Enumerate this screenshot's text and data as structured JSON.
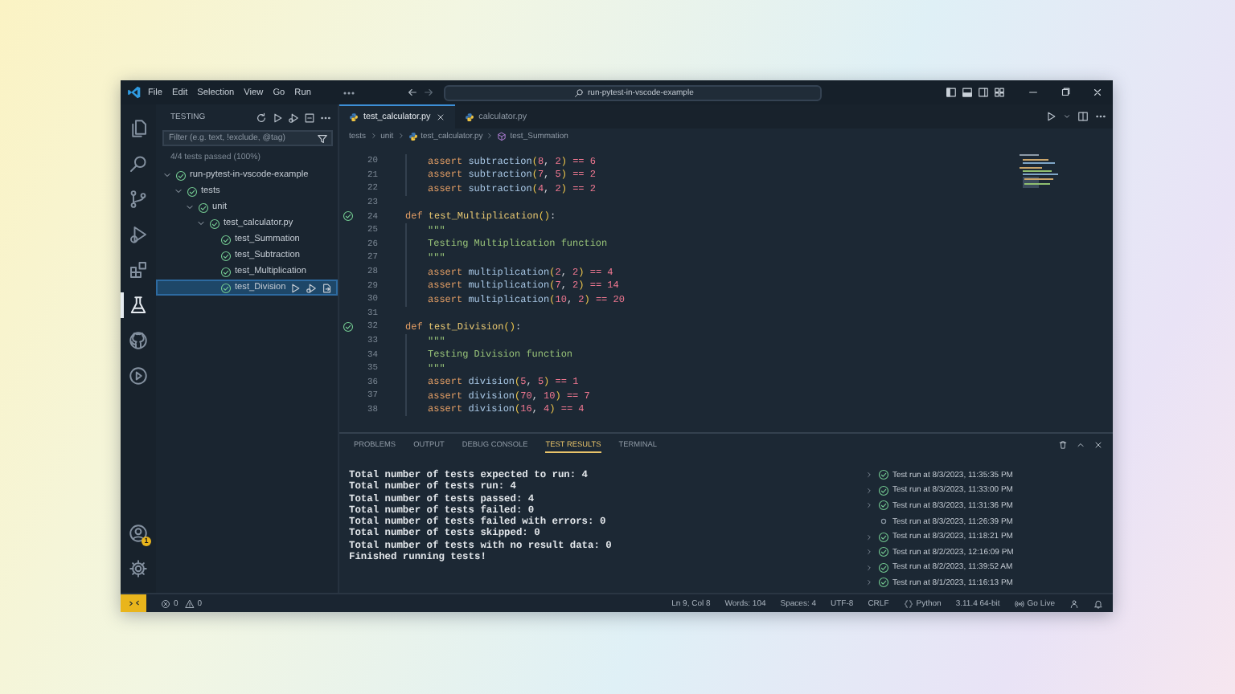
{
  "title_bar": {
    "menu": [
      "File",
      "Edit",
      "Selection",
      "View",
      "Go",
      "Run"
    ],
    "command_center": "run-pytest-in-vscode-example"
  },
  "activity_bar": {
    "items": [
      {
        "kind": "files",
        "selected": false
      },
      {
        "kind": "search",
        "selected": false
      },
      {
        "kind": "source_control",
        "selected": false
      },
      {
        "kind": "run_debug",
        "selected": false
      },
      {
        "kind": "extensions",
        "selected": false
      },
      {
        "kind": "testing",
        "selected": true
      },
      {
        "kind": "round_logo",
        "selected": false
      },
      {
        "kind": "circle_play",
        "selected": false
      }
    ],
    "bottom_items": [
      {
        "kind": "account",
        "badge": "1"
      },
      {
        "kind": "settings"
      }
    ]
  },
  "sidebar": {
    "title": "TESTING",
    "filter": {
      "placeholder": "Filter (e.g. text, !exclude, @tag)"
    },
    "summary": "4/4 tests passed (100%)",
    "tree": [
      {
        "label": "run-pytest-in-vscode-example",
        "passed": true,
        "expanded": true,
        "selected": false,
        "children": [
          {
            "label": "tests",
            "passed": true,
            "expanded": true,
            "selected": false,
            "children": [
              {
                "label": "unit",
                "passed": true,
                "expanded": true,
                "selected": false,
                "children": [
                  {
                    "label": "test_calculator.py",
                    "passed": true,
                    "expanded": true,
                    "selected": false,
                    "children": [
                      {
                        "label": "test_Summation",
                        "passed": true,
                        "selected": false
                      },
                      {
                        "label": "test_Subtraction",
                        "passed": true,
                        "selected": false
                      },
                      {
                        "label": "test_Multiplication",
                        "passed": true,
                        "selected": false
                      },
                      {
                        "label": "test_Division",
                        "passed": true,
                        "selected": true
                      }
                    ]
                  }
                ]
              }
            ]
          }
        ]
      }
    ]
  },
  "editor": {
    "tabs": [
      {
        "label": "test_calculator.py",
        "selected": true
      },
      {
        "label": "calculator.py",
        "selected": false
      }
    ],
    "breadcrumb": [
      {
        "kind": "folder",
        "text": "tests"
      },
      {
        "kind": "folder",
        "text": "unit"
      },
      {
        "kind": "file",
        "text": "test_calculator.py"
      },
      {
        "kind": "symbol",
        "text": "test_Summation"
      }
    ],
    "lines": [
      {
        "number": "20",
        "indented": true,
        "test_passed": false,
        "tokens": [
          {
            "kind": "keyword",
            "text": "assert"
          },
          {
            "kind": "call",
            "text": " subtraction"
          },
          {
            "kind": "paren",
            "text": "("
          },
          {
            "kind": "number",
            "text": "8"
          },
          {
            "kind": "plain",
            "text": ", "
          },
          {
            "kind": "number",
            "text": "2"
          },
          {
            "kind": "paren",
            "text": ")"
          },
          {
            "kind": "operator",
            "text": " == "
          },
          {
            "kind": "number",
            "text": "6"
          }
        ]
      },
      {
        "number": "21",
        "indented": true,
        "test_passed": false,
        "tokens": [
          {
            "kind": "keyword",
            "text": "assert"
          },
          {
            "kind": "call",
            "text": " subtraction"
          },
          {
            "kind": "paren",
            "text": "("
          },
          {
            "kind": "number",
            "text": "7"
          },
          {
            "kind": "plain",
            "text": ", "
          },
          {
            "kind": "number",
            "text": "5"
          },
          {
            "kind": "paren",
            "text": ")"
          },
          {
            "kind": "operator",
            "text": " == "
          },
          {
            "kind": "number",
            "text": "2"
          }
        ]
      },
      {
        "number": "22",
        "indented": true,
        "test_passed": false,
        "tokens": [
          {
            "kind": "keyword",
            "text": "assert"
          },
          {
            "kind": "call",
            "text": " subtraction"
          },
          {
            "kind": "paren",
            "text": "("
          },
          {
            "kind": "number",
            "text": "4"
          },
          {
            "kind": "plain",
            "text": ", "
          },
          {
            "kind": "number",
            "text": "2"
          },
          {
            "kind": "paren",
            "text": ")"
          },
          {
            "kind": "operator",
            "text": " == "
          },
          {
            "kind": "number",
            "text": "2"
          }
        ]
      },
      {
        "number": "23",
        "indented": false,
        "test_passed": false
      },
      {
        "number": "24",
        "indented": false,
        "test_passed": true,
        "tokens": [
          {
            "kind": "keyword",
            "text": "def"
          },
          {
            "kind": "function",
            "text": " test_Multiplication"
          },
          {
            "kind": "paren",
            "text": "()"
          },
          {
            "kind": "plain",
            "text": ":"
          }
        ]
      },
      {
        "number": "25",
        "indented": true,
        "test_passed": false,
        "tokens": [
          {
            "kind": "docstring",
            "text": "\"\"\""
          }
        ]
      },
      {
        "number": "26",
        "indented": true,
        "test_passed": false,
        "tokens": [
          {
            "kind": "docstring",
            "text": "Testing Multiplication function"
          }
        ]
      },
      {
        "number": "27",
        "indented": true,
        "test_passed": false,
        "tokens": [
          {
            "kind": "docstring",
            "text": "\"\"\""
          }
        ]
      },
      {
        "number": "28",
        "indented": true,
        "test_passed": false,
        "tokens": [
          {
            "kind": "keyword",
            "text": "assert"
          },
          {
            "kind": "call",
            "text": " multiplication"
          },
          {
            "kind": "paren",
            "text": "("
          },
          {
            "kind": "number",
            "text": "2"
          },
          {
            "kind": "plain",
            "text": ", "
          },
          {
            "kind": "number",
            "text": "2"
          },
          {
            "kind": "paren",
            "text": ")"
          },
          {
            "kind": "operator",
            "text": " == "
          },
          {
            "kind": "number",
            "text": "4"
          }
        ]
      },
      {
        "number": "29",
        "indented": true,
        "test_passed": false,
        "tokens": [
          {
            "kind": "keyword",
            "text": "assert"
          },
          {
            "kind": "call",
            "text": " multiplication"
          },
          {
            "kind": "paren",
            "text": "("
          },
          {
            "kind": "number",
            "text": "7"
          },
          {
            "kind": "plain",
            "text": ", "
          },
          {
            "kind": "number",
            "text": "2"
          },
          {
            "kind": "paren",
            "text": ")"
          },
          {
            "kind": "operator",
            "text": " == "
          },
          {
            "kind": "number",
            "text": "14"
          }
        ]
      },
      {
        "number": "30",
        "indented": true,
        "test_passed": false,
        "tokens": [
          {
            "kind": "keyword",
            "text": "assert"
          },
          {
            "kind": "call",
            "text": " multiplication"
          },
          {
            "kind": "paren",
            "text": "("
          },
          {
            "kind": "number",
            "text": "10"
          },
          {
            "kind": "plain",
            "text": ", "
          },
          {
            "kind": "number",
            "text": "2"
          },
          {
            "kind": "paren",
            "text": ")"
          },
          {
            "kind": "operator",
            "text": " == "
          },
          {
            "kind": "number",
            "text": "20"
          }
        ]
      },
      {
        "number": "31",
        "indented": false,
        "test_passed": false
      },
      {
        "number": "32",
        "indented": false,
        "test_passed": true,
        "tokens": [
          {
            "kind": "keyword",
            "text": "def"
          },
          {
            "kind": "function",
            "text": " test_Division"
          },
          {
            "kind": "paren",
            "text": "()"
          },
          {
            "kind": "plain",
            "text": ":"
          }
        ]
      },
      {
        "number": "33",
        "indented": true,
        "test_passed": false,
        "tokens": [
          {
            "kind": "docstring",
            "text": "\"\"\""
          }
        ]
      },
      {
        "number": "34",
        "indented": true,
        "test_passed": false,
        "tokens": [
          {
            "kind": "docstring",
            "text": "Testing Division function"
          }
        ]
      },
      {
        "number": "35",
        "indented": true,
        "test_passed": false,
        "tokens": [
          {
            "kind": "docstring",
            "text": "\"\"\""
          }
        ]
      },
      {
        "number": "36",
        "indented": true,
        "test_passed": false,
        "tokens": [
          {
            "kind": "keyword",
            "text": "assert"
          },
          {
            "kind": "call",
            "text": " division"
          },
          {
            "kind": "paren",
            "text": "("
          },
          {
            "kind": "number",
            "text": "5"
          },
          {
            "kind": "plain",
            "text": ", "
          },
          {
            "kind": "number",
            "text": "5"
          },
          {
            "kind": "paren",
            "text": ")"
          },
          {
            "kind": "operator",
            "text": " == "
          },
          {
            "kind": "number",
            "text": "1"
          }
        ]
      },
      {
        "number": "37",
        "indented": true,
        "test_passed": false,
        "tokens": [
          {
            "kind": "keyword",
            "text": "assert"
          },
          {
            "kind": "call",
            "text": " division"
          },
          {
            "kind": "paren",
            "text": "("
          },
          {
            "kind": "number",
            "text": "70"
          },
          {
            "kind": "plain",
            "text": ", "
          },
          {
            "kind": "number",
            "text": "10"
          },
          {
            "kind": "paren",
            "text": ")"
          },
          {
            "kind": "operator",
            "text": " == "
          },
          {
            "kind": "number",
            "text": "7"
          }
        ]
      },
      {
        "number": "38",
        "indented": true,
        "test_passed": false,
        "tokens": [
          {
            "kind": "keyword",
            "text": "assert"
          },
          {
            "kind": "call",
            "text": " division"
          },
          {
            "kind": "paren",
            "text": "("
          },
          {
            "kind": "number",
            "text": "16"
          },
          {
            "kind": "plain",
            "text": ", "
          },
          {
            "kind": "number",
            "text": "4"
          },
          {
            "kind": "paren",
            "text": ")"
          },
          {
            "kind": "operator",
            "text": " == "
          },
          {
            "kind": "number",
            "text": "4"
          }
        ]
      }
    ]
  },
  "panel": {
    "tabs": [
      {
        "label": "PROBLEMS",
        "selected": false
      },
      {
        "label": "OUTPUT",
        "selected": false
      },
      {
        "label": "DEBUG CONSOLE",
        "selected": false
      },
      {
        "label": "TEST RESULTS",
        "selected": true
      },
      {
        "label": "TERMINAL",
        "selected": false
      }
    ],
    "output": [
      "Total number of tests expected to run: 4",
      "Total number of tests run: 4",
      "Total number of tests passed: 4",
      "Total number of tests failed: 0",
      "Total number of tests failed with errors: 0",
      "Total number of tests skipped: 0",
      "Total number of tests with no result data: 0",
      "Finished running tests!"
    ],
    "results": [
      {
        "label": "Test run at 8/3/2023, 11:35:35 PM",
        "passed": true,
        "expandable": true
      },
      {
        "label": "Test run at 8/3/2023, 11:33:00 PM",
        "passed": true,
        "expandable": true
      },
      {
        "label": "Test run at 8/3/2023, 11:31:36 PM",
        "passed": true,
        "expandable": true
      },
      {
        "label": "Test run at 8/3/2023, 11:26:39 PM",
        "passed": false,
        "expandable": false
      },
      {
        "label": "Test run at 8/3/2023, 11:18:21 PM",
        "passed": true,
        "expandable": true
      },
      {
        "label": "Test run at 8/2/2023, 12:16:09 PM",
        "passed": true,
        "expandable": true
      },
      {
        "label": "Test run at 8/2/2023, 11:39:52 AM",
        "passed": true,
        "expandable": true
      },
      {
        "label": "Test run at 8/1/2023, 11:16:13 PM",
        "passed": true,
        "expandable": true
      }
    ]
  },
  "status_bar": {
    "errors": "0",
    "warnings": "0",
    "items": [
      {
        "kind": "text",
        "text": "Ln 9, Col 8"
      },
      {
        "kind": "text",
        "text": "Words: 104"
      },
      {
        "kind": "text",
        "text": "Spaces: 4"
      },
      {
        "kind": "text",
        "text": "UTF-8"
      },
      {
        "kind": "text",
        "text": "CRLF"
      },
      {
        "kind": "language",
        "text": "Python"
      },
      {
        "kind": "text",
        "text": "3.11.4 64-bit"
      },
      {
        "kind": "live",
        "text": "Go Live"
      }
    ]
  }
}
